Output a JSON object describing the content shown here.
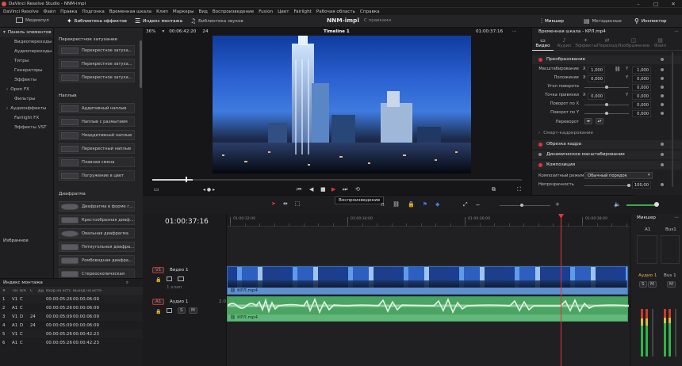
{
  "titlebar": {
    "title": "DaVinci Resolve Studio - NNM-impl"
  },
  "menu": [
    "DaVinci Resolve",
    "Файл",
    "Правка",
    "Подгонка",
    "Временная шкала",
    "Клип",
    "Маркеры",
    "Вид",
    "Воспроизведение",
    "Fusion",
    "Цвет",
    "Fairlight",
    "Рабочая область",
    "Справка"
  ],
  "toolbar": {
    "media": "Медиапул",
    "effects": "Библиотека эффектов",
    "edit_index": "Индекс монтажа",
    "sound": "Библиотека звуков",
    "project": "NNM-impl",
    "changes": "С правками",
    "mixer": "Микшер",
    "metadata": "Метаданные",
    "inspector": "Инспектор"
  },
  "viewer_bar": {
    "zoom": "36%",
    "tc_left": "00:06:42:20",
    "fps": "24",
    "timeline": "Timeline 1",
    "tc_right": "01:00:37:16",
    "insp_title": "Временная шкала - КРЛ.mp4"
  },
  "effects_panel": {
    "header": "Панель элементов",
    "tree": [
      "Видеопереходы",
      "Аудиопереходы",
      "Титры",
      "Генераторы",
      "Эффекты",
      "Open FX",
      "Фильтры",
      "Аудиоэффекты",
      "Fairlight FX",
      "Эффекты VST"
    ],
    "favorites": "Избранное",
    "sec1": "Перекрестное затухание",
    "items1": [
      "Перекрестное затуха...",
      "Перекрестное затуха...",
      "Перекрестное затуха..."
    ],
    "sec2": "Наплыв",
    "items2": [
      "Аддитивный наплыв",
      "Наплыв с размытием",
      "Неаддитивный наплыв",
      "Перекрестный наплыв",
      "Плавная смена",
      "Погружение в цвет"
    ],
    "sec3": "Диафрагма",
    "items3": [
      "Диафрагма в форме г...",
      "Крестообразная диаф...",
      "Овальная диафрагма",
      "Пятиугольная диафра...",
      "Ромбовидная диафра...",
      "Стереоскопическая"
    ]
  },
  "edit_index": {
    "title": "Индекс монтажа",
    "cols": [
      "#",
      "Том",
      "В/А",
      "С",
      "Дур.",
      "Вход на источн",
      "Выход на источн"
    ],
    "rows": [
      [
        "1",
        "V1",
        "С",
        "",
        "",
        "00:00:05:26",
        "00:00:06:09"
      ],
      [
        "2",
        "A1",
        "С",
        "",
        "",
        "00:00:05:26",
        "00:00:06:09"
      ],
      [
        "3",
        "V1",
        "D",
        "24",
        "",
        "00:00:05:09",
        "00:00:06:09"
      ],
      [
        "4",
        "A1",
        "D",
        "24",
        "",
        "00:00:05:09",
        "00:00:06:09"
      ],
      [
        "5",
        "V1",
        "С",
        "",
        "",
        "00:00:05:26",
        "00:00:42:23"
      ],
      [
        "6",
        "A1",
        "С",
        "",
        "",
        "00:00:05:26",
        "00:00:42:23"
      ]
    ]
  },
  "timeline": {
    "timecode": "01:00:37:16",
    "ruler": [
      "01:00:32:00",
      "01:00:34:00",
      "01:00:36:00",
      "01:00:38:00"
    ],
    "v1": "V1",
    "v1_name": "Видео 1",
    "v1_clips": "1 клип",
    "a1": "A1",
    "a1_name": "Аудио 1",
    "a1_ch": "2.0",
    "clip_video": "КРЛ.mp4",
    "clip_audio": "КРЛ.mp4",
    "tooltip": "Воспроизведение"
  },
  "inspector": {
    "tabs": [
      "Видео",
      "Аудио",
      "Эффекты",
      "Переход",
      "Изображение",
      "Файл"
    ],
    "transform": "Преобразование",
    "scale": "Масштабирование",
    "pos": "Положение",
    "rot": "Угол поворота",
    "anchor": "Точка привязки",
    "pitch": "Поворот по X",
    "yaw": "Поворот по Y",
    "flip": "Переворот",
    "x": "X",
    "y": "Y",
    "scale_x": "1,000",
    "scale_y": "1,000",
    "pos_x": "0,000",
    "pos_y": "0,000",
    "rot_v": "0,000",
    "anc_x": "0,000",
    "anc_y": "0,000",
    "pitch_v": "0,000",
    "yaw_v": "0,000",
    "smart": "Смарт-кадрирование",
    "crop": "Обрезка кадра",
    "dyn": "Динамическое масштабирование",
    "comp": "Композиция",
    "blend_l": "Композитный режим",
    "blend_v": "Обычный порядок",
    "opacity_l": "Непрозрачность",
    "opacity_v": "100,00"
  },
  "mixer": {
    "title": "Микшер",
    "a1": "A1",
    "bus": "Bus1",
    "audio1": "Аудио 1",
    "bus2": "Bus 1",
    "m": "M",
    "s": "S"
  }
}
